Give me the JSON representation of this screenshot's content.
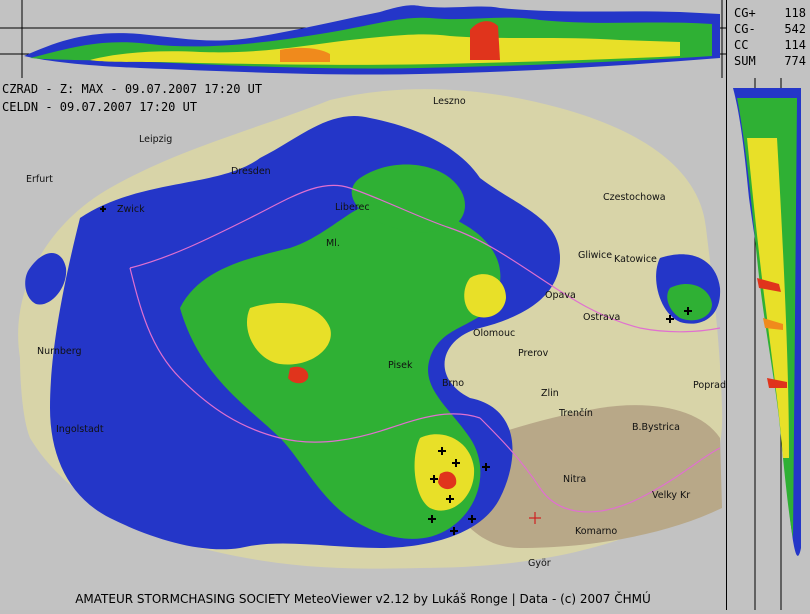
{
  "header": {
    "line1": "CZRAD - Z: MAX - 09.07.2007 17:20 UT",
    "line2": "CELDN - 09.07.2007 17:20 UT"
  },
  "lightning_stats": [
    {
      "label": "CG+",
      "value": "118"
    },
    {
      "label": "CG-",
      "value": "542"
    },
    {
      "label": "CC",
      "value": "114"
    },
    {
      "label": "SUM",
      "value": "774"
    }
  ],
  "cities": [
    "Leszno",
    "Leipzig",
    "Dresden",
    "Erfurt",
    "Zwick",
    "Liberec",
    "Ml.",
    "Czestochowa",
    "Gliwice",
    "Katowice",
    "Opava",
    "Ostrava",
    "Olomouc",
    "Prerov",
    "Nurnberg",
    "Ingolstadt",
    "Zlin",
    "Poprad",
    "Trenčín",
    "B.Bystrica",
    "Nitra",
    "Velky Kr",
    "Komarno",
    "Györ",
    "Pisek",
    "Brno"
  ],
  "footer": {
    "credit": "AMATEUR STORMCHASING SOCIETY MeteoViewer v2.12 by Lukáš Ronge | Data - (c) 2007 ČHMÚ"
  },
  "colors": {
    "terrain": "#d8d4a8",
    "echo_blue": "#2436c8",
    "echo_green": "#2fb034",
    "echo_yellow": "#e8e028",
    "echo_red": "#e0341c",
    "border": "#e070d0"
  }
}
